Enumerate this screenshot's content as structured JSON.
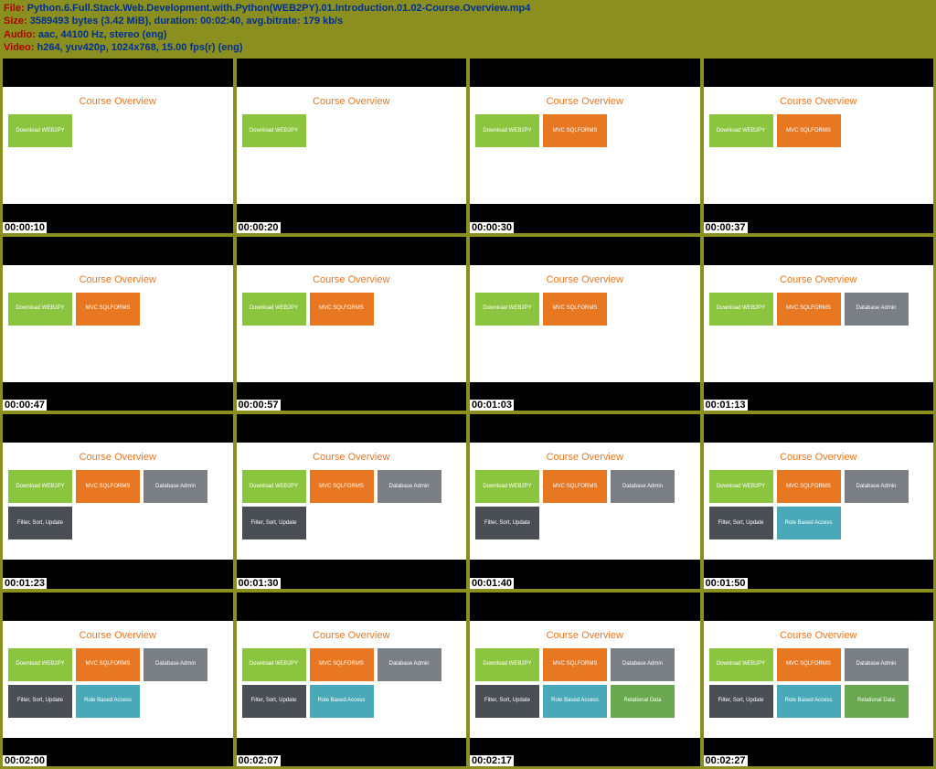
{
  "header": {
    "file_label": "File: ",
    "file_value": "Python.6.Full.Stack.Web.Development.with.Python(WEB2PY).01.Introduction.01.02-Course.Overview.mp4",
    "size_label": "Size: ",
    "size_value": "3589493 bytes (3.42 MiB), duration: 00:02:40, avg.bitrate: 179 kb/s",
    "audio_label": "Audio: ",
    "audio_value": "aac, 44100 Hz, stereo (eng)",
    "video_label": "Video: ",
    "video_value": "h264, yuv420p, 1024x768, 15.00 fps(r) (eng)"
  },
  "slide_title": "Course Overview",
  "tile_labels": {
    "download": "Download WEB2PY",
    "mvc": "MVC SQLFORMS",
    "dbadmin": "Database Admin",
    "filter": "Filter, Sort, Update",
    "rba": "Role Based Access",
    "reldata": "Relational Data"
  },
  "frames": [
    {
      "time": "00:00:10",
      "tiles": [
        "download"
      ]
    },
    {
      "time": "00:00:20",
      "tiles": [
        "download"
      ]
    },
    {
      "time": "00:00:30",
      "tiles": [
        "download",
        "mvc"
      ]
    },
    {
      "time": "00:00:37",
      "tiles": [
        "download",
        "mvc"
      ]
    },
    {
      "time": "00:00:47",
      "tiles": [
        "download",
        "mvc"
      ]
    },
    {
      "time": "00:00:57",
      "tiles": [
        "download",
        "mvc"
      ]
    },
    {
      "time": "00:01:03",
      "tiles": [
        "download",
        "mvc"
      ]
    },
    {
      "time": "00:01:13",
      "tiles": [
        "download",
        "mvc",
        "dbadmin"
      ]
    },
    {
      "time": "00:01:23",
      "tiles": [
        "download",
        "mvc",
        "dbadmin",
        "filter"
      ]
    },
    {
      "time": "00:01:30",
      "tiles": [
        "download",
        "mvc",
        "dbadmin",
        "filter"
      ]
    },
    {
      "time": "00:01:40",
      "tiles": [
        "download",
        "mvc",
        "dbadmin",
        "filter"
      ]
    },
    {
      "time": "00:01:50",
      "tiles": [
        "download",
        "mvc",
        "dbadmin",
        "filter",
        "rba"
      ]
    },
    {
      "time": "00:02:00",
      "tiles": [
        "download",
        "mvc",
        "dbadmin",
        "filter",
        "rba"
      ]
    },
    {
      "time": "00:02:07",
      "tiles": [
        "download",
        "mvc",
        "dbadmin",
        "filter",
        "rba"
      ]
    },
    {
      "time": "00:02:17",
      "tiles": [
        "download",
        "mvc",
        "dbadmin",
        "filter",
        "rba",
        "reldata"
      ]
    },
    {
      "time": "00:02:27",
      "tiles": [
        "download",
        "mvc",
        "dbadmin",
        "filter",
        "rba",
        "reldata"
      ]
    }
  ],
  "tile_colors": {
    "download": "c-green",
    "mvc": "c-orange",
    "dbadmin": "c-gray",
    "filter": "c-dark",
    "rba": "c-teal",
    "reldata": "c-green2"
  }
}
